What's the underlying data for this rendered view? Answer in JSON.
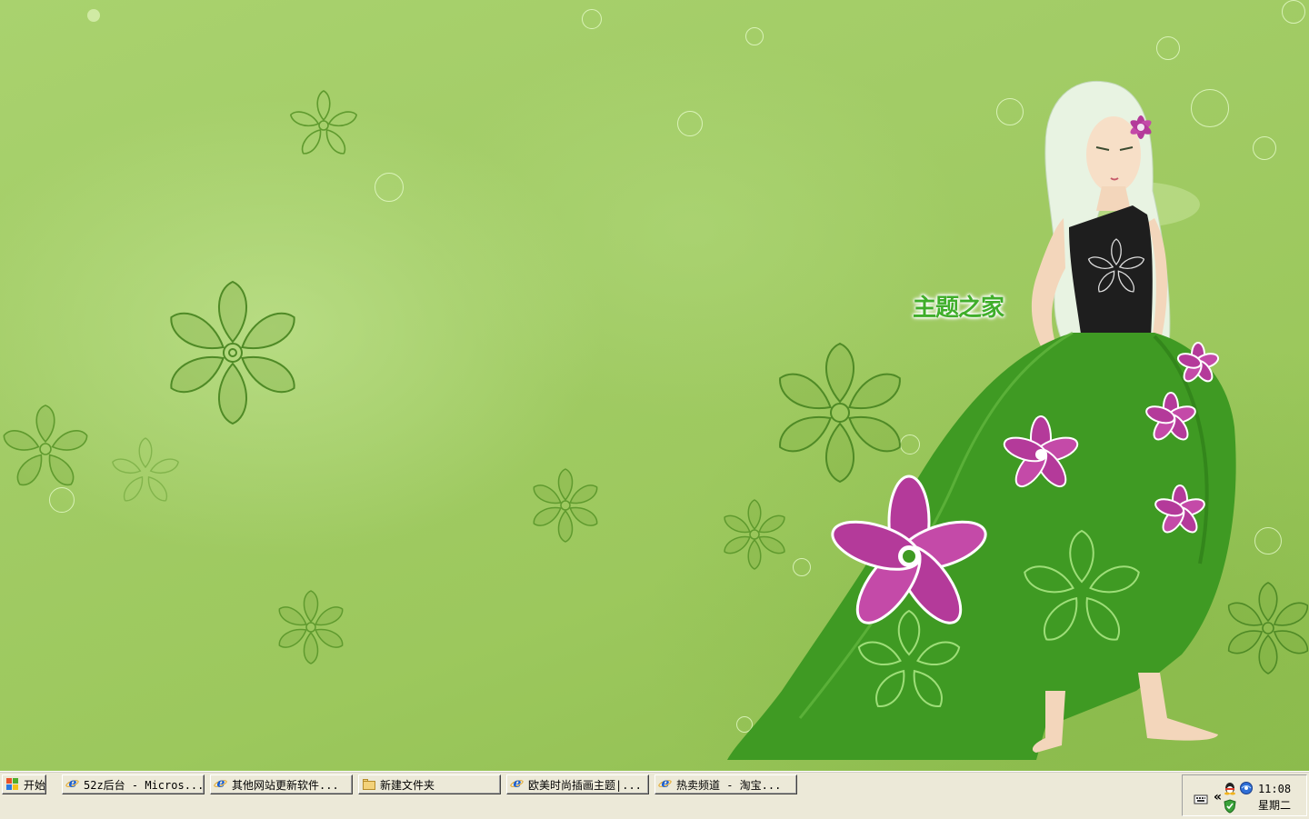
{
  "desktop": {
    "wallpaper": "green floral illustration of a woman in a green flowered gown",
    "watermark": "主题之家",
    "colors": {
      "background": "#a2cc66",
      "dress": "#3f9a23",
      "flower_accent": "#b43a9a"
    }
  },
  "taskbar": {
    "start_label": "开始",
    "tasks": [
      {
        "label": "52z后台 - Micros...",
        "icon": "ie-icon"
      },
      {
        "label": "其他网站更新软件...",
        "icon": "ie-icon"
      },
      {
        "label": "新建文件夹",
        "icon": "folder-icon"
      },
      {
        "label": "欧美时尚插画主题|...",
        "icon": "ie-icon"
      },
      {
        "label": "热卖频道 - 淘宝...",
        "icon": "ie-icon"
      }
    ],
    "tray": {
      "expand_label": "«",
      "icons": [
        "keyboard-icon",
        "qq-icon",
        "network-icon",
        "security-shield-icon"
      ],
      "time": "11:08",
      "day": "星期二"
    }
  }
}
